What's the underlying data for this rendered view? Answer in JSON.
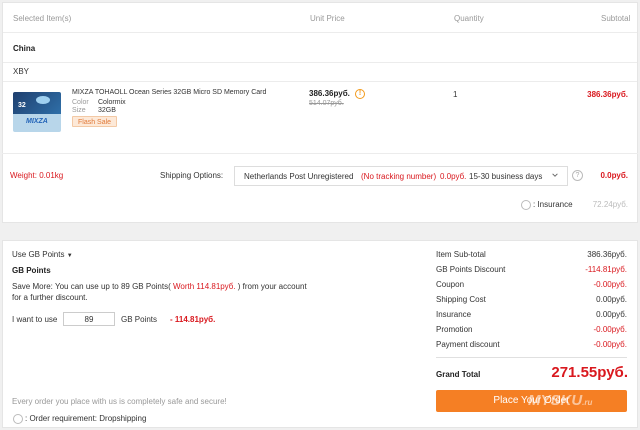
{
  "table_header": {
    "selected_items": "Selected Item(s)",
    "unit_price": "Unit Price",
    "quantity": "Quantity",
    "subtotal": "Subtotal"
  },
  "warehouse": "China",
  "store": "XBY",
  "item": {
    "title": "MIXZA TOHAOLL Ocean Series 32GB Micro SD Memory Card",
    "color_label": "Color",
    "color_value": "Colormix",
    "size_label": "Size",
    "size_value": "32GB",
    "badge": "Flash Sale",
    "unit_price": "386.36руб.",
    "original_price": "514.07руб.",
    "quantity": "1",
    "subtotal": "386.36руб.",
    "thumb_brand": "MIXZA",
    "thumb_capacity": "32"
  },
  "shipping": {
    "weight": "Weight: 0.01kg",
    "options_label": "Shipping Options:",
    "method": "Netherlands Post Unregistered",
    "tracking_note": "(No tracking number)",
    "method_cost": "0.0руб.",
    "delivery_time": "15-30 business days",
    "cost": "0.0руб.",
    "insurance_label": ": Insurance",
    "insurance_price": "72.24руб."
  },
  "points": {
    "toggle_label": "Use GB Points",
    "title": "GB Points",
    "info_prefix": "Save More: You can use up to 89 GB Points(",
    "info_worth": " Worth 114.81руб. ",
    "info_suffix": ") from your account",
    "info_line2": "for a further discount.",
    "want_label": "I want to use",
    "input_value": "89",
    "unit_label": "GB Points",
    "discount": "- 114.81руб."
  },
  "footer": {
    "safety_note": "Every order you place with us is completely safe and secure!",
    "order_requirement": ": Order requirement: Dropshipping"
  },
  "summary": {
    "rows": [
      {
        "label": "Item Sub-total",
        "value": "386.36руб."
      },
      {
        "label": "GB Points Discount",
        "value": "-114.81руб."
      },
      {
        "label": "Coupon",
        "value": "-0.00руб."
      },
      {
        "label": "Shipping Cost",
        "value": "0.00руб."
      },
      {
        "label": "Insurance",
        "value": "0.00руб."
      },
      {
        "label": "Promotion",
        "value": "-0.00руб."
      },
      {
        "label": "Payment discount",
        "value": "-0.00руб."
      }
    ],
    "grand_total_label": "Grand Total",
    "grand_total_value": "271.55руб.",
    "place_order": "Place Your Order"
  },
  "watermark": {
    "text": "MYSKU",
    "suffix": ".ru"
  },
  "colors": {
    "accent_red": "#d9181e",
    "button_orange": "#f57f24",
    "warn_orange": "#f39a1b"
  },
  "icons": [
    "warning-icon",
    "chevron-down-icon",
    "help-icon",
    "radio-icon"
  ]
}
